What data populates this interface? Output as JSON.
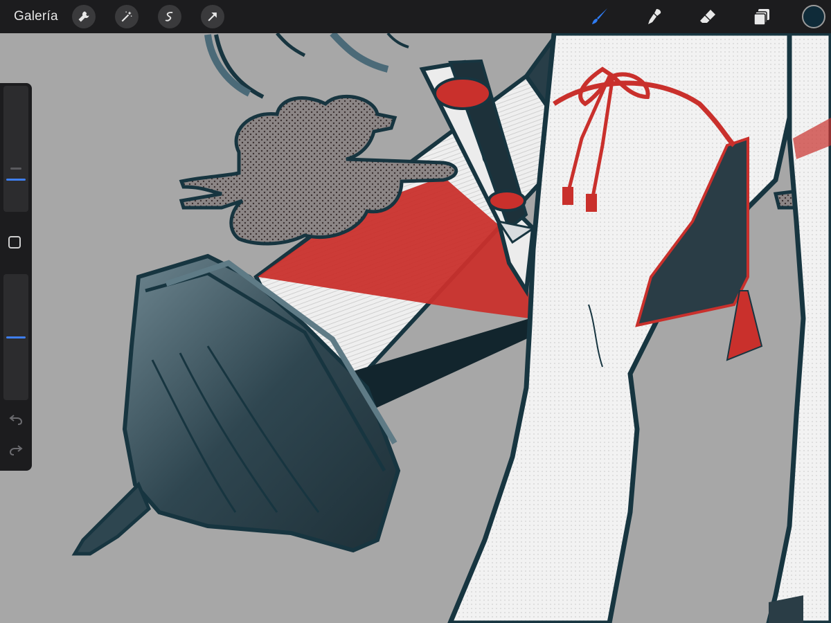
{
  "toolbar": {
    "gallery_label": "Galería",
    "left_tools": [
      "wrench-icon",
      "magic-wand-icon",
      "selection-icon",
      "transform-arrow-icon"
    ],
    "right_tools": [
      "brush-icon",
      "smudge-icon",
      "eraser-icon",
      "layers-icon"
    ],
    "active_tool": "brush-icon",
    "accent_color": "#2f7bf2",
    "current_color": "#0f2b39"
  },
  "sidebar": {
    "brush_size_level": 0.25,
    "opacity_level": 0.5
  },
  "colors": {
    "canvas_background": "#a7a7a7",
    "line_art": "#173540",
    "accent_red": "#c9302c",
    "skin_white": "#f4f4f4"
  }
}
